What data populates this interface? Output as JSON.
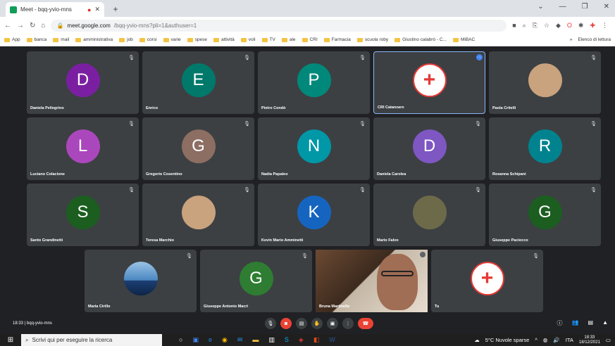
{
  "browser": {
    "tab_title": "Meet - bqq-yvio-mns",
    "new_tab": "+",
    "url_host": "meet.google.com",
    "url_path": "/bqq-yvio-mns?pli=1&authuser=1",
    "bookmarks": [
      "App",
      "banca",
      "mail",
      "amministrativa",
      "job",
      "corsi",
      "varie",
      "spese",
      "attività",
      "voli",
      "TV",
      "ale",
      "CRI",
      "Farmacia",
      "scuola roby",
      "Giustino calabrò - C...",
      "MiBAC"
    ],
    "reading_list": "Elenco di lettura"
  },
  "meet": {
    "meeting_code": "bqq-yvio-mns",
    "time": "18:33",
    "participants": [
      {
        "name": "Daniela Pellegrino",
        "initial": "D",
        "color": "#7b1fa2"
      },
      {
        "name": "Enrico",
        "initial": "E",
        "color": "#00796b"
      },
      {
        "name": "Pietro Condò",
        "initial": "P",
        "color": "#00897b"
      },
      {
        "name": "CRI Catanzaro",
        "initial": "",
        "color": "#ffffff"
      },
      {
        "name": "Paola Critelli",
        "initial": "",
        "color": "#c9a27e"
      },
      {
        "name": "Luciano Colacione",
        "initial": "L",
        "color": "#ab47bc"
      },
      {
        "name": "Gregorio Cosentino",
        "initial": "G",
        "color": "#8d6e63"
      },
      {
        "name": "Nadia Papaleo",
        "initial": "N",
        "color": "#0097a7"
      },
      {
        "name": "Daniela Carolea",
        "initial": "D",
        "color": "#7e57c2"
      },
      {
        "name": "Rosanna Schipani",
        "initial": "R",
        "color": "#00838f"
      },
      {
        "name": "Santo Grandinetti",
        "initial": "S",
        "color": "#1b5e20"
      },
      {
        "name": "Teresa Marchio",
        "initial": "",
        "color": "#c9a27e"
      },
      {
        "name": "Kevin Mario Amminetti",
        "initial": "K",
        "color": "#1565c0"
      },
      {
        "name": "Mario Falvo",
        "initial": "",
        "color": "#6d6a4a"
      },
      {
        "name": "Giuseppe Paciocco",
        "initial": "G",
        "color": "#1b5e20"
      },
      {
        "name": "Maria Cirillo",
        "initial": "",
        "color": "#4a87c1"
      },
      {
        "name": "Giuseppe Antonio Macrì",
        "initial": "G",
        "color": "#2e7d32"
      },
      {
        "name": "Bruna Martinello",
        "initial": "",
        "color": "#a06d55"
      },
      {
        "name": "Tu",
        "initial": "",
        "color": "#ffffff"
      }
    ]
  },
  "taskbar": {
    "search_placeholder": "Scrivi qui per eseguire la ricerca",
    "weather": "5°C  Nuvole sparse",
    "lang": "ITA",
    "time": "18:33",
    "date": "18/12/2021"
  }
}
